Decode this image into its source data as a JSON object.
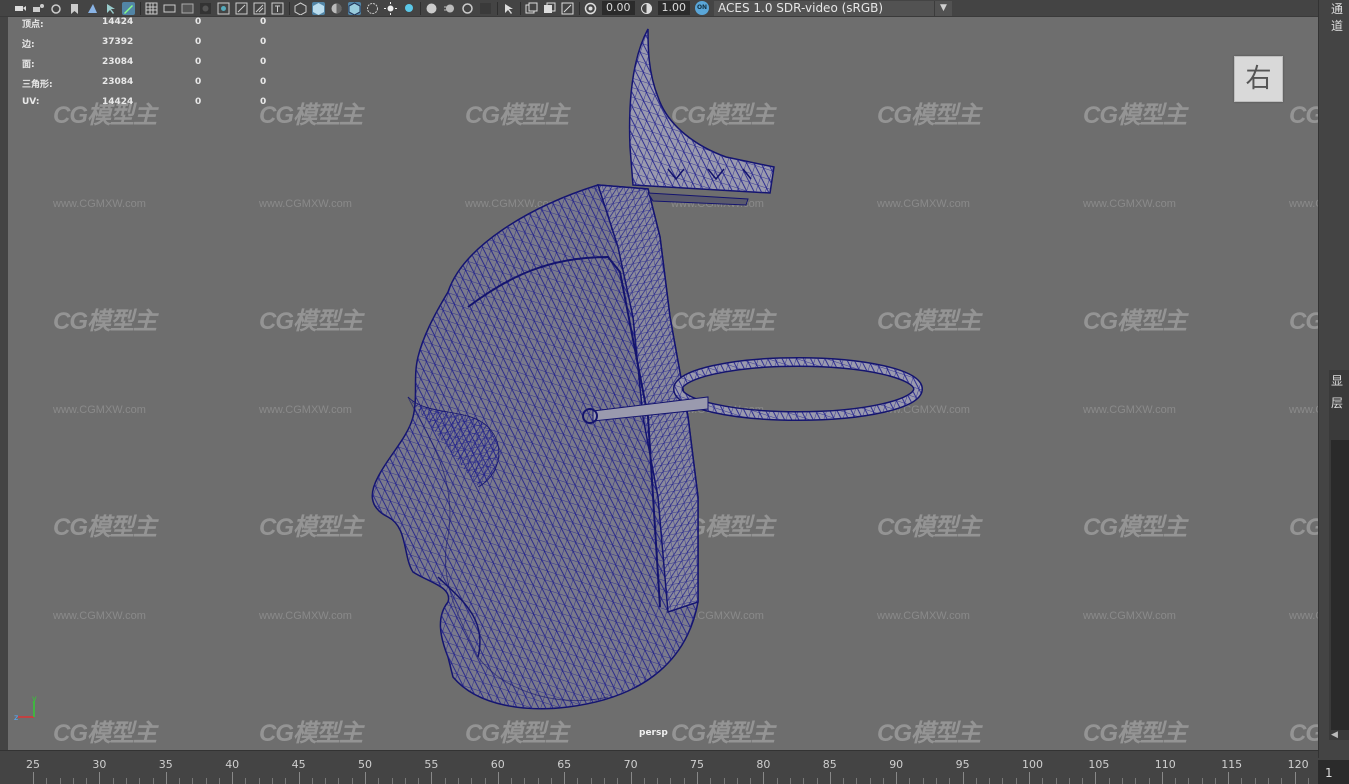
{
  "toolbar": {
    "icons": [
      "camera-icon",
      "camera-attr-icon",
      "bookmark-icon",
      "bookmark-icon",
      "image-plane-icon",
      "grid-icon",
      "film-gate-icon",
      "resolution-gate-icon",
      "gate-mask-icon",
      "field-chart-icon",
      "safe-action-icon",
      "safe-title-icon",
      "wireframe-icon",
      "smooth-shade-icon",
      "default-material-icon",
      "wireframe-on-shaded-icon",
      "xray-icon",
      "textured-icon",
      "lights-icon",
      "shadows-icon",
      "ao-icon",
      "motion-blur-icon",
      "aa-icon",
      "dof-icon",
      "isolate-icon",
      "xray-joints-icon",
      "xray-active-icon",
      "select-camera-icon",
      "panel-layout-icon",
      "resolution-icon"
    ],
    "exposure_value": "0.00",
    "gamma_value": "1.00",
    "cs_badge": "ON",
    "colorspace": "ACES 1.0 SDR-video (sRGB)"
  },
  "hud": {
    "rows": [
      {
        "label": "顶点:",
        "v1": "14424",
        "v2": "0",
        "v3": "0"
      },
      {
        "label": "边:",
        "v1": "37392",
        "v2": "0",
        "v3": "0"
      },
      {
        "label": "面:",
        "v1": "23084",
        "v2": "0",
        "v3": "0"
      },
      {
        "label": "三角形:",
        "v1": "23084",
        "v2": "0",
        "v3": "0"
      },
      {
        "label": "UV:",
        "v1": "14424",
        "v2": "0",
        "v3": "0"
      }
    ]
  },
  "viewcube": {
    "label": "右"
  },
  "camera_label": "persp",
  "axis": {
    "y": "y",
    "z": "z"
  },
  "watermark": {
    "logo": "CG模型主",
    "url": "www.CGMXW.com"
  },
  "right_panel": {
    "top_label": "通道",
    "label1": "显",
    "label2": "层"
  },
  "timeline": {
    "ticks": [
      "25",
      "30",
      "35",
      "40",
      "45",
      "50",
      "55",
      "60",
      "65",
      "70",
      "75",
      "80",
      "85",
      "90",
      "95",
      "100",
      "105",
      "110",
      "115",
      "120"
    ],
    "current_frame": "1"
  },
  "colors": {
    "viewport_bg": "#6e6e6e",
    "wire": "#1a1a8c",
    "ui_bg": "#444444",
    "active_tool": "#5285a6"
  }
}
